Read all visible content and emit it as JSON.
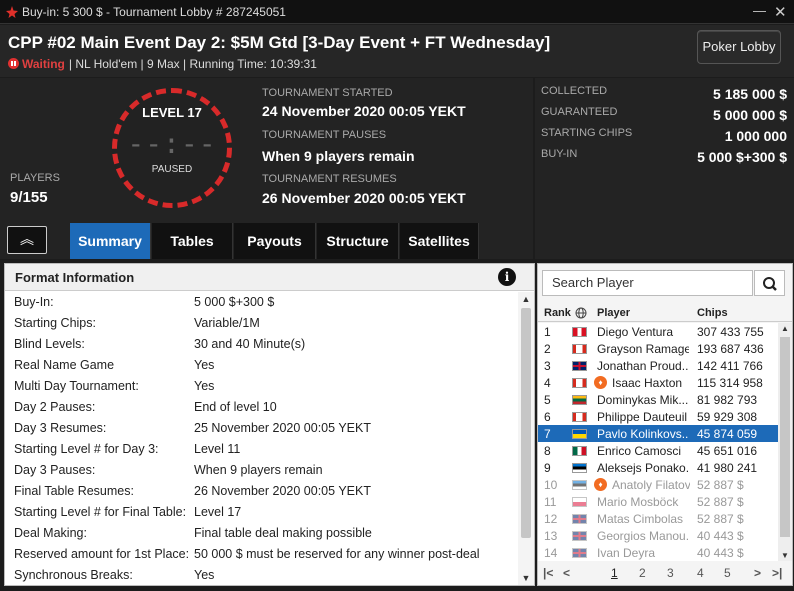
{
  "window": {
    "title": "Buy-in: 5 300 $ - Tournament Lobby # 287245051",
    "min_glyph": "—",
    "close_glyph": "✕"
  },
  "header": {
    "event_title": "CPP #02 Main Event Day 2: $5M Gtd [3-Day Event + FT Wednesday]",
    "status": "Waiting",
    "details": "| NL Hold'em | 9 Max | Running Time: 10:39:31",
    "lobby_button": "Poker Lobby"
  },
  "clock": {
    "level": "LEVEL 17",
    "time": "--:--",
    "state": "PAUSED"
  },
  "players": {
    "label": "PLAYERS",
    "value": "9/155"
  },
  "schedule": [
    {
      "label": "TOURNAMENT STARTED",
      "value": "24 November 2020  00:05 YEKT"
    },
    {
      "label": "TOURNAMENT PAUSES",
      "value": "When 9 players remain"
    },
    {
      "label": "TOURNAMENT RESUMES",
      "value": "26 November 2020  00:05 YEKT"
    }
  ],
  "stats": [
    {
      "label": "COLLECTED",
      "value": "5 185 000 $"
    },
    {
      "label": "GUARANTEED",
      "value": "5 000 000 $"
    },
    {
      "label": "STARTING CHIPS",
      "value": "1 000 000"
    },
    {
      "label": "BUY-IN",
      "value": "5 000 $+300 $"
    }
  ],
  "collapse_glyph": "︽",
  "tabs": [
    "Summary",
    "Tables",
    "Payouts",
    "Structure",
    "Satellites"
  ],
  "format": {
    "title": "Format Information",
    "info_glyph": "i",
    "rows": [
      {
        "k": "Buy-In:",
        "v": "5 000 $+300 $"
      },
      {
        "k": "Starting Chips:",
        "v": "Variable/1M"
      },
      {
        "k": "Blind Levels:",
        "v": "30 and 40 Minute(s)"
      },
      {
        "k": "Real Name Game",
        "v": "Yes"
      },
      {
        "k": "Multi Day Tournament:",
        "v": "Yes"
      },
      {
        "k": "Day 2 Pauses:",
        "v": "End of level 10"
      },
      {
        "k": "Day 3 Resumes:",
        "v": "25 November 2020  00:05 YEKT"
      },
      {
        "k": "Starting Level # for  Day 3:",
        "v": "Level 11"
      },
      {
        "k": "Day 3 Pauses:",
        "v": "When 9 players remain"
      },
      {
        "k": "Final Table Resumes:",
        "v": "26 November 2020  00:05 YEKT"
      },
      {
        "k": "Starting Level # for  Final Table:",
        "v": "Level 17"
      },
      {
        "k": "Deal Making:",
        "v": "Final table deal making possible"
      },
      {
        "k": "Reserved amount for 1st Place:",
        "v": "50 000 $ must be reserved for any winner post-deal"
      },
      {
        "k": "Synchronous Breaks:",
        "v": "Yes"
      }
    ]
  },
  "player_list": {
    "search_placeholder": "Search Player",
    "headers": {
      "rank": "Rank",
      "player": "Player",
      "chips": "Chips"
    },
    "rows": [
      {
        "rank": "1",
        "flag": "peru",
        "name": "Diego Ventura",
        "chips": "307 433 755",
        "badge": false,
        "state": "normal"
      },
      {
        "rank": "2",
        "flag": "canada",
        "name": "Grayson Ramage",
        "chips": "193 687 436",
        "badge": false,
        "state": "normal"
      },
      {
        "rank": "3",
        "flag": "uk",
        "name": "Jonathan Proud...",
        "chips": "142 411 766",
        "badge": false,
        "state": "normal"
      },
      {
        "rank": "4",
        "flag": "canada",
        "name": "Isaac Haxton",
        "chips": "115 314 958",
        "badge": true,
        "state": "normal"
      },
      {
        "rank": "5",
        "flag": "lithuania",
        "name": "Dominykas Mik...",
        "chips": "81 982 793",
        "badge": false,
        "state": "normal"
      },
      {
        "rank": "6",
        "flag": "canada",
        "name": "Philippe Dauteuil",
        "chips": "59 929 308",
        "badge": false,
        "state": "normal"
      },
      {
        "rank": "7",
        "flag": "ukraine",
        "name": "Pavlo Kolinkovs...",
        "chips": "45 874 059",
        "badge": false,
        "state": "selected"
      },
      {
        "rank": "8",
        "flag": "mexico",
        "name": "Enrico Camosci",
        "chips": "45 651 016",
        "badge": false,
        "state": "normal"
      },
      {
        "rank": "9",
        "flag": "estonia",
        "name": "Aleksejs Ponako...",
        "chips": "41 980 241",
        "badge": false,
        "state": "normal"
      },
      {
        "rank": "10",
        "flag": "estonia",
        "name": "Anatoly Filatov",
        "chips": "52 887 $",
        "badge": true,
        "state": "dim"
      },
      {
        "rank": "11",
        "flag": "poland",
        "name": "Mario Mosböck",
        "chips": "52 887 $",
        "badge": false,
        "state": "dim"
      },
      {
        "rank": "12",
        "flag": "uk",
        "name": "Matas Cimbolas",
        "chips": "52 887 $",
        "badge": false,
        "state": "dim"
      },
      {
        "rank": "13",
        "flag": "uk",
        "name": "Georgios Manou...",
        "chips": "40 443 $",
        "badge": false,
        "state": "dim"
      },
      {
        "rank": "14",
        "flag": "uk",
        "name": "Ivan Deyra",
        "chips": "40 443 $",
        "badge": false,
        "state": "dim"
      }
    ],
    "pager": {
      "first": "|<",
      "prev": "<",
      "pages": [
        "1",
        "2",
        "3",
        "4",
        "5"
      ],
      "current": "1",
      "next": ">",
      "last": ">|"
    },
    "badge_glyph": "♦",
    "scroll_up": "▲",
    "scroll_down": "▼"
  },
  "colors": {
    "accent": "#1d6ab8",
    "status_red": "#e04040",
    "clock_ring": "#d82a2a"
  }
}
